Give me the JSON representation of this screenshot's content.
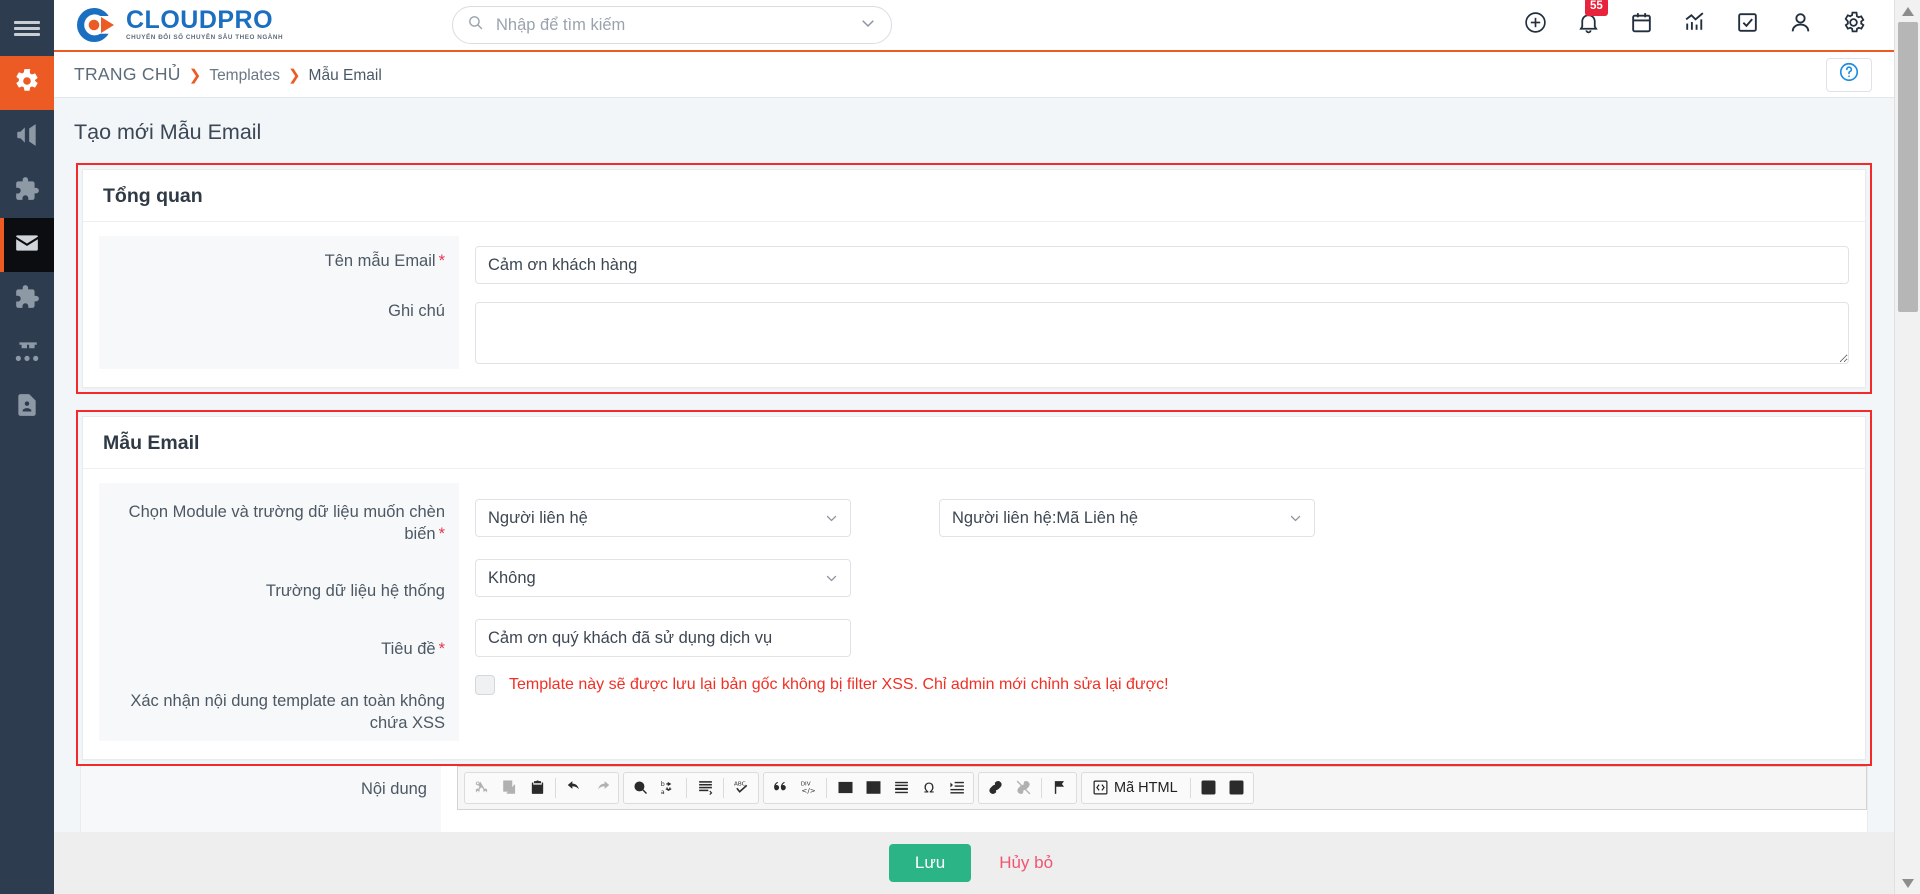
{
  "brand": {
    "name": "CLOUDPRO",
    "tagline": "CHUYỂN ĐỔI SỐ CHUYÊN SÂU THEO NGÀNH",
    "primary_color": "#ec5b24",
    "logo_blue": "#1b6fc0"
  },
  "search": {
    "placeholder": "Nhập để tìm kiếm",
    "value": ""
  },
  "header": {
    "icons": [
      {
        "name": "add-circle-icon",
        "label": "Thêm mới"
      },
      {
        "name": "bell-icon",
        "label": "Thông báo",
        "badge": "55"
      },
      {
        "name": "calendar-icon",
        "label": "Lịch"
      },
      {
        "name": "chart-icon",
        "label": "Báo cáo"
      },
      {
        "name": "checkbox-icon",
        "label": "Công việc"
      },
      {
        "name": "user-icon",
        "label": "Tài khoản"
      },
      {
        "name": "gear-icon",
        "label": "Cài đặt"
      }
    ],
    "notification_badge": "55"
  },
  "sidebar": {
    "items": [
      {
        "name": "sidebar-item-settings",
        "icon": "gear-icon",
        "state": "active-orange"
      },
      {
        "name": "sidebar-item-marketing",
        "icon": "megaphone-icon",
        "state": "normal"
      },
      {
        "name": "sidebar-item-module-1",
        "icon": "puzzle-icon",
        "state": "normal"
      },
      {
        "name": "sidebar-item-email",
        "icon": "envelope-icon",
        "state": "active-dark"
      },
      {
        "name": "sidebar-item-module-2",
        "icon": "puzzle-icon",
        "state": "normal"
      },
      {
        "name": "sidebar-item-organization",
        "icon": "org-chart-icon",
        "state": "normal"
      },
      {
        "name": "sidebar-item-contacts",
        "icon": "contact-card-icon",
        "state": "normal"
      }
    ]
  },
  "breadcrumb": {
    "home": "TRANG CHỦ",
    "separator": "❯",
    "items": [
      "Templates",
      "Mẫu Email"
    ]
  },
  "help": {
    "label": "?"
  },
  "page": {
    "title": "Tạo mới Mẫu Email"
  },
  "overview_panel": {
    "title": "Tổng quan",
    "fields": {
      "template_name": {
        "label": "Tên mẫu Email",
        "required": "*",
        "value": "Cảm ơn khách hàng",
        "placeholder": ""
      },
      "note": {
        "label": "Ghi chú",
        "value": "",
        "placeholder": ""
      }
    }
  },
  "email_panel": {
    "title": "Mẫu Email",
    "fields": {
      "module_field": {
        "label": "Chọn Module và trường dữ liệu muốn chèn biến",
        "required": "*",
        "module_value": "Người liên hệ",
        "field_value": "Người liên hệ:Mã Liên hệ"
      },
      "system_field": {
        "label": "Trường dữ liệu hệ thống",
        "value": "Không"
      },
      "subject": {
        "label": "Tiêu đề",
        "required": "*",
        "value": "Cảm ơn quý khách đã sử dụng dịch vụ"
      },
      "xss_confirm": {
        "label": "Xác nhận nội dung template an toàn không chứa XSS",
        "checked": false,
        "warning": "Template này sẽ được lưu lại bản gốc không bị filter XSS. Chỉ admin mới chỉnh sửa lại được!",
        "warning_color": "#f03024"
      },
      "content": {
        "label": "Nội dung"
      }
    }
  },
  "editor_toolbar": {
    "groups": [
      {
        "name": "clipboard",
        "buttons": [
          {
            "name": "cut-icon",
            "title": "Cắt",
            "disabled": true
          },
          {
            "name": "copy-icon",
            "title": "Sao chép",
            "disabled": true
          },
          {
            "name": "paste-icon",
            "title": "Dán",
            "disabled": false
          },
          {
            "name": "undo-icon",
            "title": "Hoàn tác",
            "disabled": false
          },
          {
            "name": "redo-icon",
            "title": "Làm lại",
            "disabled": true
          }
        ]
      },
      {
        "name": "editing",
        "buttons": [
          {
            "name": "find-icon",
            "title": "Tìm kiếm",
            "disabled": false
          },
          {
            "name": "replace-icon",
            "title": "Thay thế",
            "disabled": false
          },
          {
            "name": "select-all-icon",
            "title": "Chọn tất cả",
            "disabled": false
          },
          {
            "name": "spellcheck-icon",
            "title": "Kiểm tra chính tả",
            "disabled": false
          }
        ]
      },
      {
        "name": "insert",
        "buttons": [
          {
            "name": "blockquote-icon",
            "title": "Trích dẫn",
            "disabled": false
          },
          {
            "name": "div-container-icon",
            "title": "Tạo khối Div",
            "disabled": false
          },
          {
            "name": "image-icon",
            "title": "Hình ảnh",
            "disabled": false
          },
          {
            "name": "table-icon",
            "title": "Bảng",
            "disabled": false
          },
          {
            "name": "horizontal-rule-icon",
            "title": "Đường kẻ ngang",
            "disabled": false
          },
          {
            "name": "special-char-icon",
            "title": "Ký tự đặc biệt",
            "disabled": false
          },
          {
            "name": "page-break-icon",
            "title": "Ngắt trang",
            "disabled": false
          }
        ]
      },
      {
        "name": "links",
        "buttons": [
          {
            "name": "link-icon",
            "title": "Chèn liên kết",
            "disabled": false
          },
          {
            "name": "unlink-icon",
            "title": "Bỏ liên kết",
            "disabled": true
          },
          {
            "name": "anchor-icon",
            "title": "Neo",
            "disabled": false
          }
        ]
      },
      {
        "name": "tools",
        "buttons": [
          {
            "name": "source-html-icon",
            "title": "Mã HTML",
            "label": "Mã HTML",
            "disabled": false
          },
          {
            "name": "maximize-icon",
            "title": "Phóng to",
            "disabled": false
          },
          {
            "name": "preview-icon",
            "title": "Xem trước",
            "disabled": false
          }
        ]
      }
    ],
    "source_label": "Mã HTML"
  },
  "footer": {
    "save_label": "Lưu",
    "cancel_label": "Hủy bỏ",
    "save_color": "#2bb587",
    "cancel_color": "#f05570"
  }
}
